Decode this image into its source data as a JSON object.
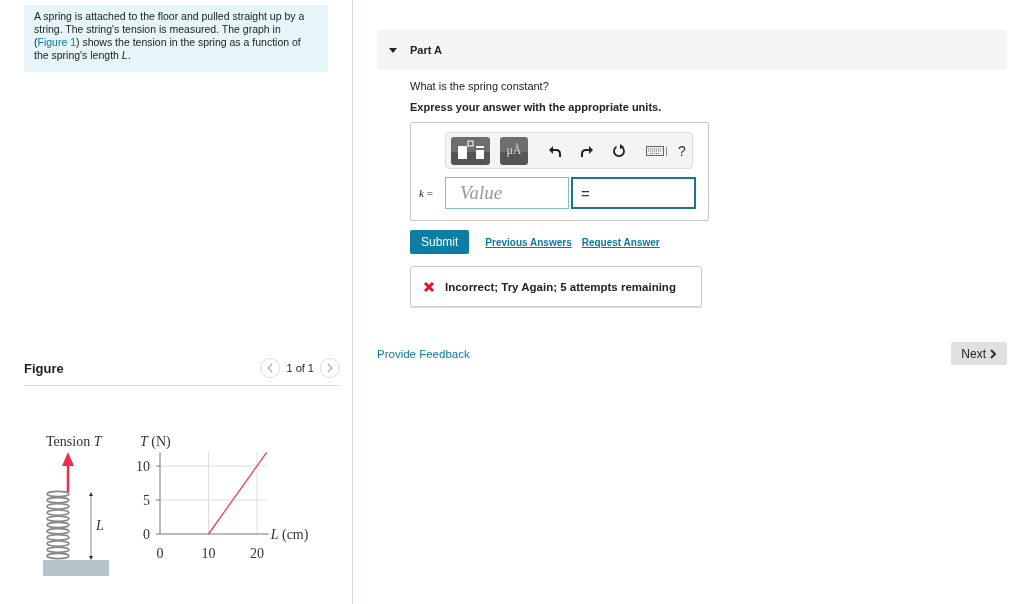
{
  "intro": {
    "before": "A spring is attached to the floor and pulled straight up by a string. The string's tension is measured. The graph in (",
    "link": "Figure 1",
    "after": ") shows the tension in the spring as a function of the spring's length *L*."
  },
  "figure": {
    "title": "Figure",
    "pager": "1 of 1",
    "tension_label": "Tension *T*",
    "length_label": "*L*",
    "chart_data": {
      "type": "line",
      "xlabel": "*L* (cm)",
      "ylabel": "*T* (N)",
      "x": [
        10,
        22
      ],
      "series": [
        {
          "color": "#ee3b5b",
          "values": [
            0,
            12
          ]
        }
      ],
      "grid": true,
      "xlim": [
        0,
        22
      ],
      "ylim": [
        0,
        12
      ],
      "xticks": [
        0,
        10,
        20
      ],
      "yticks": [
        0,
        5,
        10
      ]
    }
  },
  "part": {
    "title": "Part A",
    "expanded": true,
    "question": "What is the spring constant?",
    "instruction": "Express your answer with the appropriate units.",
    "toolbar": {
      "units_button": "μÅ",
      "help": "?"
    },
    "answer": {
      "variable": "*k* =",
      "placeholder": "Value",
      "units": "="
    },
    "submit": "Submit",
    "links": [
      "Previous Answers",
      "Request Answer"
    ],
    "feedback": {
      "correct": false,
      "message": "Incorrect; Try Again; 5 attempts remaining"
    }
  },
  "provide_feedback": "Provide Feedback",
  "next": "Next"
}
